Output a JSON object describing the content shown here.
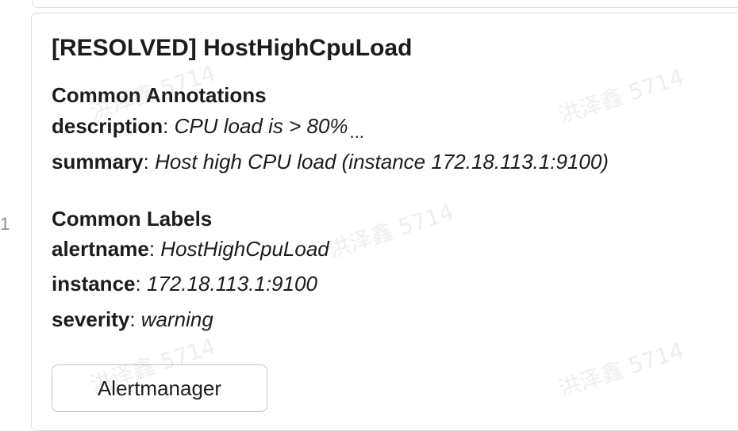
{
  "gutter": {
    "line_number": "1"
  },
  "message": {
    "title": "[RESOLVED] HostHighCpuLoad",
    "annotations": {
      "heading": "Common Annotations",
      "items": [
        {
          "key": "description",
          "sep": ": ",
          "value": "CPU load is > 80%",
          "truncated": "..."
        },
        {
          "key": "summary",
          "sep": ": ",
          "value": "Host high CPU load (instance 172.18.113.1:9100)"
        }
      ]
    },
    "labels": {
      "heading": "Common Labels",
      "items": [
        {
          "key": "alertname",
          "sep": ": ",
          "value": "HostHighCpuLoad"
        },
        {
          "key": "instance",
          "sep": ": ",
          "value": "172.18.113.1:9100"
        },
        {
          "key": "severity",
          "sep": ": ",
          "value": "warning"
        }
      ]
    },
    "button_label": "Alertmanager"
  },
  "watermark": {
    "text": "洪泽鑫 5714"
  }
}
